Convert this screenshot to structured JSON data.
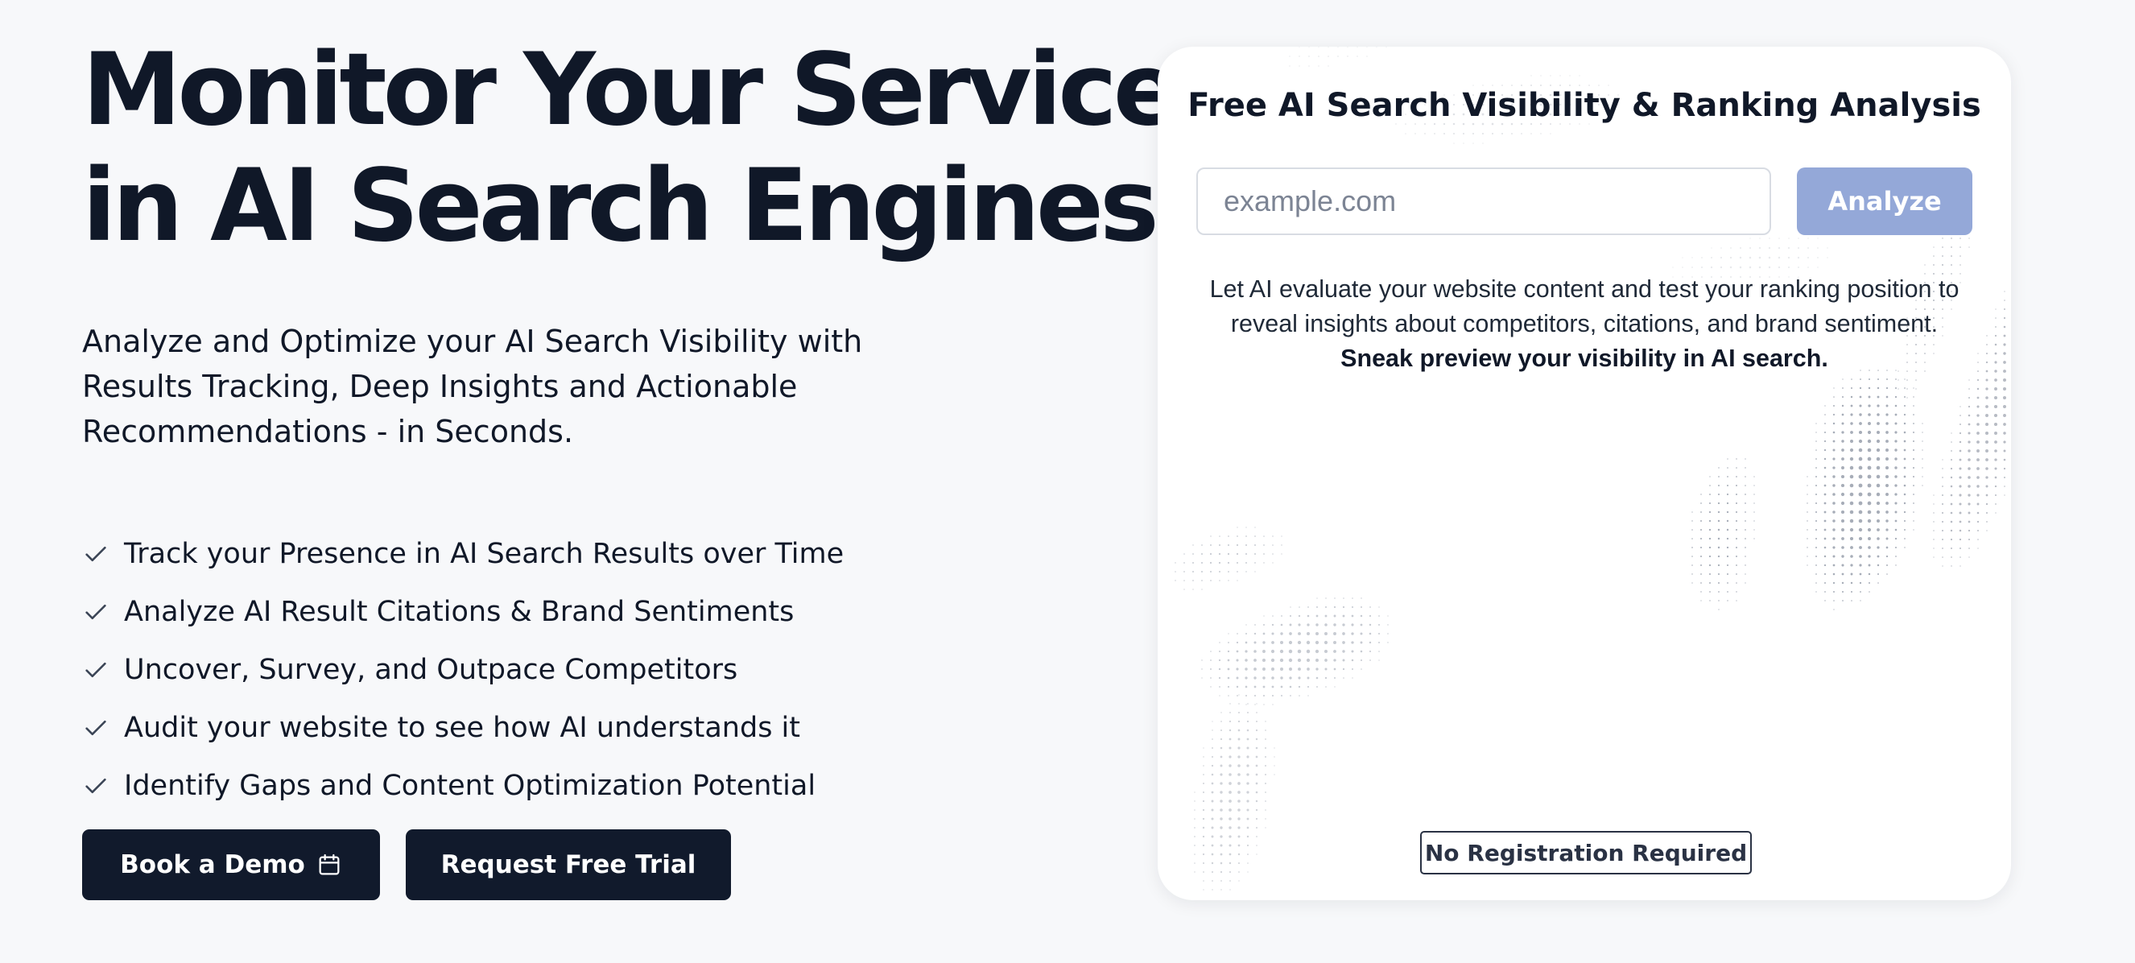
{
  "hero": {
    "title_line1": "Monitor Your Service",
    "title_line2": "in AI Search Engines",
    "subtitle": "Analyze and Optimize your AI Search Visibility with Results Tracking, Deep Insights and Actionable Recommendations - in Seconds.",
    "features": [
      "Track your Presence in AI Search Results over Time",
      "Analyze AI Result Citations & Brand Sentiments",
      "Uncover, Survey, and Outpace Competitors",
      "Audit your website to see how AI understands it",
      "Identify Gaps and Content Optimization Potential"
    ],
    "feature_icon": "check-icon",
    "book_demo_label": "Book a Demo",
    "book_demo_icon": "calendar-icon",
    "request_trial_label": "Request Free Trial"
  },
  "card": {
    "title": "Free AI Search Visibility & Ranking Analysis",
    "input_placeholder": "example.com",
    "input_value": "",
    "analyze_label": "Analyze",
    "description_text": "Let AI evaluate your website content and test your ranking position to reveal insights about competitors, citations, and brand sentiment.",
    "description_bold": "Sneak preview your visibility in AI search.",
    "badge": "No Registration Required"
  },
  "colors": {
    "page_background": "#f7f8fa",
    "text_primary": "#101828",
    "button_dark": "#111a2c",
    "analyze_button_disabled": "#94a8d8",
    "card_background": "#ffffff"
  }
}
